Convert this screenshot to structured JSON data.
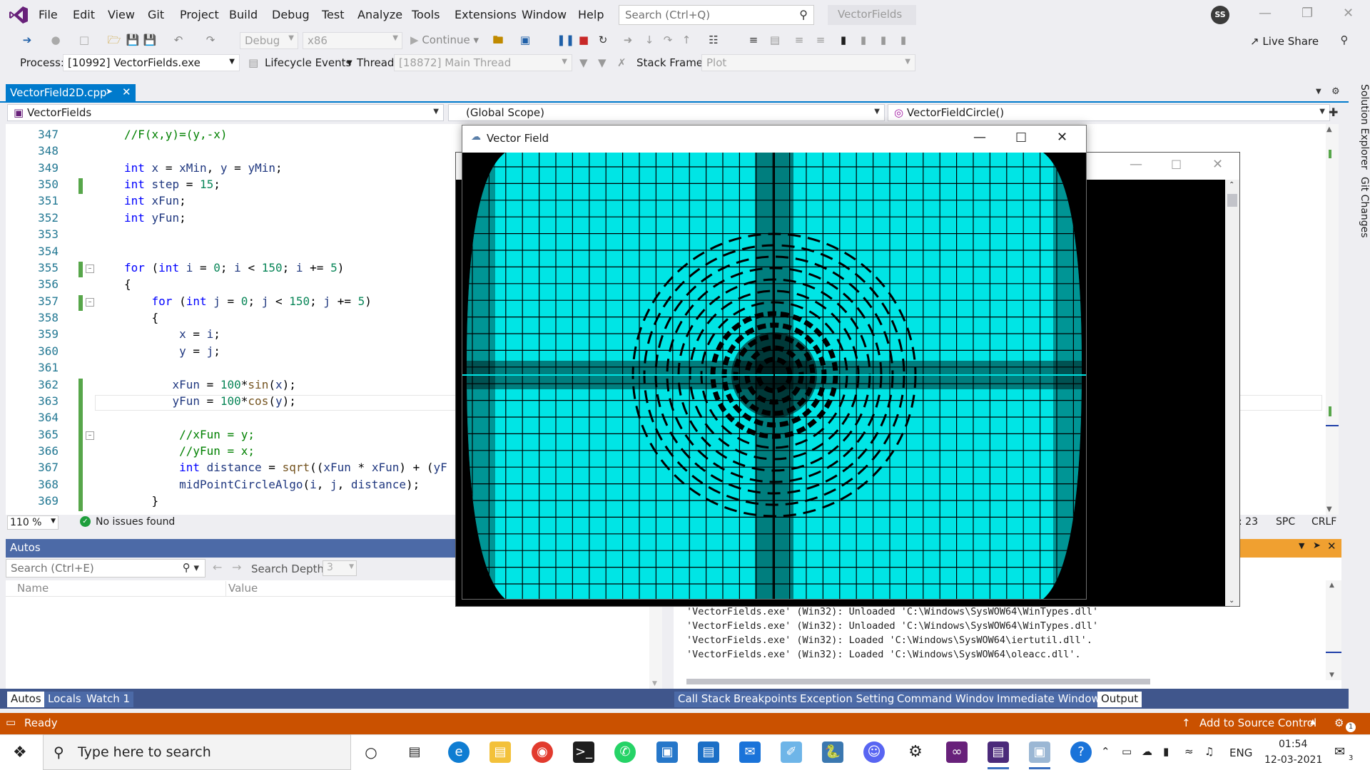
{
  "app": {
    "menu": [
      "File",
      "Edit",
      "View",
      "Git",
      "Project",
      "Build",
      "Debug",
      "Test",
      "Analyze",
      "Tools",
      "Extensions",
      "Window",
      "Help"
    ],
    "search_placeholder": "Search (Ctrl+Q)",
    "project_name": "VectorFields",
    "user_initials": "SS"
  },
  "toolbar": {
    "config": "Debug",
    "platform": "x86",
    "continue_label": "Continue",
    "live_share_label": "Live Share",
    "process_label": "Process:",
    "process_value": "[10992] VectorFields.exe",
    "lifecycle_label": "Lifecycle Events",
    "thread_label": "Thread:",
    "thread_value": "[18872] Main Thread",
    "stackframe_label": "Stack Frame:",
    "stackframe_value": "Plot"
  },
  "editor": {
    "tab_name": "VectorField2D.cpp",
    "nav_project": "VectorFields",
    "nav_scope": "(Global Scope)",
    "nav_member": "VectorFieldCircle()",
    "lines": [
      {
        "n": "347",
        "code": "//F(x,y)=(y,-x)"
      },
      {
        "n": "348",
        "code": ""
      },
      {
        "n": "349",
        "code": "int x = xMin, y = yMin;"
      },
      {
        "n": "350",
        "code": "int step = 15;"
      },
      {
        "n": "351",
        "code": "int xFun;"
      },
      {
        "n": "352",
        "code": "int yFun;"
      },
      {
        "n": "353",
        "code": ""
      },
      {
        "n": "354",
        "code": ""
      },
      {
        "n": "355",
        "code": "for (int i = 0; i < 150; i += 5)"
      },
      {
        "n": "356",
        "code": "{"
      },
      {
        "n": "357",
        "code": "    for (int j = 0; j < 150; j += 5)"
      },
      {
        "n": "358",
        "code": "    {"
      },
      {
        "n": "359",
        "code": "        x = i;"
      },
      {
        "n": "360",
        "code": "        y = j;"
      },
      {
        "n": "361",
        "code": ""
      },
      {
        "n": "362",
        "code": "       xFun = 100*sin(x);"
      },
      {
        "n": "363",
        "code": "       yFun = 100*cos(y);"
      },
      {
        "n": "364",
        "code": ""
      },
      {
        "n": "365",
        "code": "        //xFun = y;"
      },
      {
        "n": "366",
        "code": "        //yFun = x;"
      },
      {
        "n": "367",
        "code": "        int distance = sqrt((xFun * xFun) + (yF"
      },
      {
        "n": "368",
        "code": "        midPointCircleAlgo(i, j, distance);"
      },
      {
        "n": "369",
        "code": "    }"
      }
    ],
    "zoom": "110 %",
    "issues": "No issues found",
    "col_info": ": 23",
    "spc": "SPC",
    "crlf": "CRLF"
  },
  "autos": {
    "title": "Autos",
    "search_placeholder": "Search (Ctrl+E)",
    "depth_label": "Search Depth:",
    "depth_value": "3",
    "col_name": "Name",
    "col_value": "Value",
    "tabs": [
      "Autos",
      "Locals",
      "Watch 1"
    ]
  },
  "output": {
    "lines": [
      "'VectorFields.exe' (Win32): Unloaded 'C:\\Windows\\SysWOW64\\WinTypes.dll'",
      "'VectorFields.exe' (Win32): Unloaded 'C:\\Windows\\SysWOW64\\WinTypes.dll'",
      "'VectorFields.exe' (Win32): Loaded 'C:\\Windows\\SysWOW64\\iertutil.dll'.",
      "'VectorFields.exe' (Win32): Loaded 'C:\\Windows\\SysWOW64\\oleacc.dll'."
    ],
    "tabs": [
      "Call Stack",
      "Breakpoints",
      "Exception Settings",
      "Command Window",
      "Immediate Window",
      "Output"
    ]
  },
  "side_tabs": [
    "Solution Explorer",
    "Git Changes"
  ],
  "vector_window": {
    "title": "Vector Field",
    "background": "#000000",
    "field_color": "#00e5e5"
  },
  "status": {
    "ready": "Ready",
    "source_control": "Add to Source Control",
    "notifications": "1"
  },
  "taskbar": {
    "search_placeholder": "Type here to search",
    "lang": "ENG",
    "time": "01:54",
    "date": "12-03-2021",
    "notif": "3"
  }
}
